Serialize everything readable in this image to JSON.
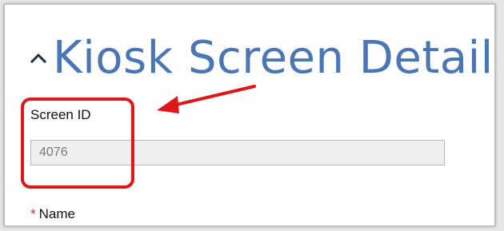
{
  "section": {
    "title": "Kiosk Screen Details",
    "collapse_icon": "chevron-up-icon"
  },
  "fields": {
    "screen_id": {
      "label": "Screen ID",
      "value": "4076"
    },
    "name": {
      "required_marker": "*",
      "label": "Name"
    }
  },
  "annotation": {
    "color": "#e0161a",
    "arrow_icon": "arrow-left-icon"
  },
  "colors": {
    "title": "#4a76b6",
    "readonly_field_bg": "#efefef"
  }
}
